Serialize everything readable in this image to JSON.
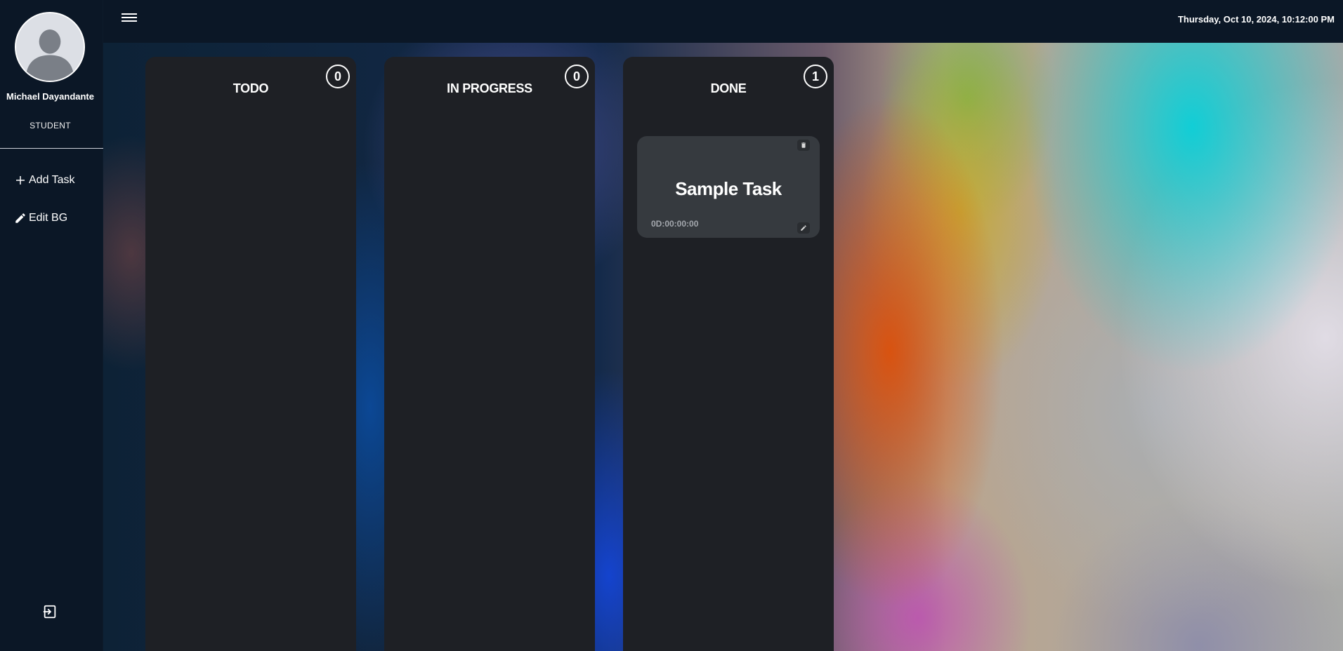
{
  "user": {
    "name": "Michael Dayandante",
    "role": "STUDENT"
  },
  "sidebar": {
    "items": [
      {
        "label": "Add Task",
        "icon": "plus-icon"
      },
      {
        "label": "Edit BG",
        "icon": "pencil-icon"
      }
    ],
    "logout_icon": "logout-icon"
  },
  "header": {
    "menu_icon": "hamburger-menu-icon",
    "datetime": "Thursday, Oct 10, 2024, 10:12:00 PM"
  },
  "board": {
    "columns": [
      {
        "title": "TODO",
        "count": "0",
        "tasks": []
      },
      {
        "title": "IN PROGRESS",
        "count": "0",
        "tasks": []
      },
      {
        "title": "DONE",
        "count": "1",
        "tasks": [
          {
            "title": "Sample Task",
            "timer": "0D:00:00:00"
          }
        ]
      }
    ]
  },
  "colors": {
    "sidebar_bg": "#0b1726",
    "column_bg": "#1e2025",
    "card_bg": "#363a3f"
  }
}
